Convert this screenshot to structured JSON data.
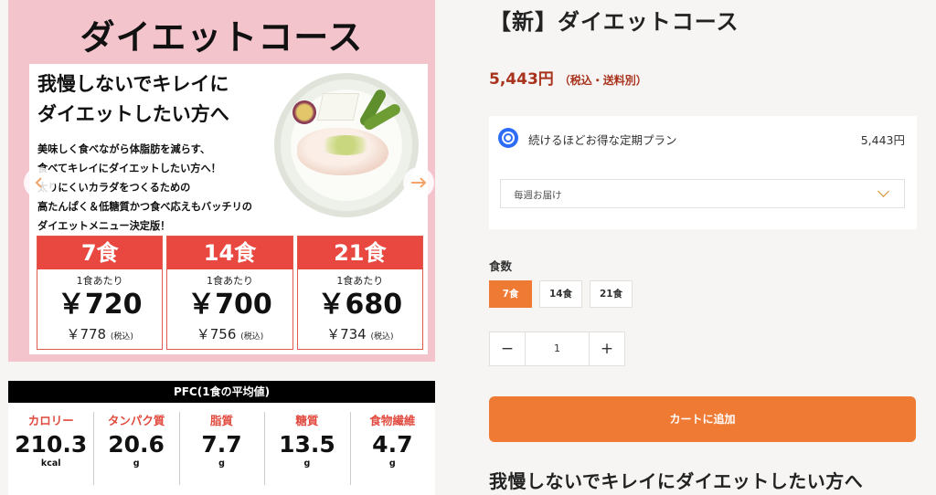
{
  "hero": {
    "title": "ダイエットコース",
    "headline": "我慢しないでキレイに\nダイエットしたい方へ",
    "description": "美味しく食べながら体脂肪を減らす、\n食べてキレイにダイエットしたい方へ！\n太りにくいカラダをつくるための\n高たんぱく＆低糖質かつ食べ応えもバッチリの\nダイエットメニュー決定版！",
    "price_boxes": [
      {
        "count": "7食",
        "per": "1食あたり",
        "price": "￥720",
        "tax_price": "￥778",
        "tax_label": "(税込)"
      },
      {
        "count": "14食",
        "per": "1食あたり",
        "price": "￥700",
        "tax_price": "￥756",
        "tax_label": "(税込)"
      },
      {
        "count": "21食",
        "per": "1食あたり",
        "price": "￥680",
        "tax_price": "￥734",
        "tax_label": "(税込)"
      }
    ],
    "prev_icon": "chevron-left-icon",
    "next_icon": "chevron-right-icon"
  },
  "pfc": {
    "title": "PFC(1食の平均値)",
    "items": [
      {
        "label": "カロリー",
        "value": "210.3",
        "unit": "kcal"
      },
      {
        "label": "タンパク質",
        "value": "20.6",
        "unit": "g"
      },
      {
        "label": "脂質",
        "value": "7.7",
        "unit": "g"
      },
      {
        "label": "糖質",
        "value": "13.5",
        "unit": "g"
      },
      {
        "label": "食物繊維",
        "value": "4.7",
        "unit": "g"
      }
    ]
  },
  "product": {
    "title": "【新】ダイエットコース",
    "price": "5,443円",
    "price_note": "（税込・送料別）",
    "plan": {
      "name": "続けるほどお得な定期プラン",
      "price": "5,443円",
      "frequency": "毎週お届け"
    },
    "quantity_label": "食数",
    "options": [
      "7食",
      "14食",
      "21食"
    ],
    "selected_option": "7食",
    "stepper": {
      "minus": "−",
      "value": "1",
      "plus": "+"
    },
    "cart_button": "カートに追加",
    "subheading": "我慢しないでキレイにダイエットしたい方へ"
  },
  "colors": {
    "accent": "#ef7a34",
    "price": "#a8321c",
    "hero_bg": "#f4c4cd",
    "box_red": "#e8483f",
    "radio": "#2c6cf6"
  }
}
